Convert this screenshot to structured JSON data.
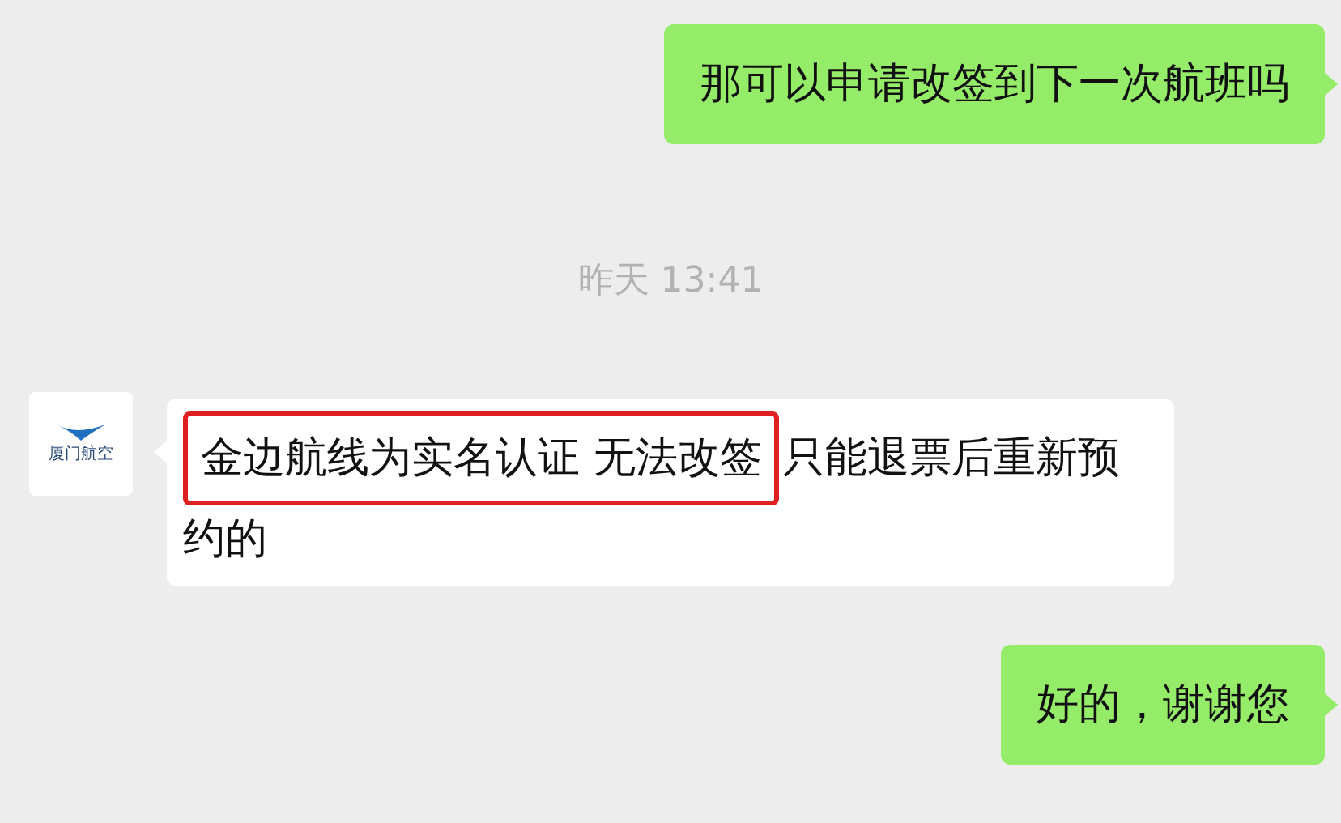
{
  "messages": [
    {
      "kind": "outgoing",
      "text": "那可以申请改签到下一次航班吗"
    },
    {
      "kind": "timestamp",
      "text": "昨天 13:41"
    },
    {
      "kind": "incoming",
      "avatar_label": "厦门航空",
      "highlighted": "金边航线为实名认证 无法改签",
      "text": "只能退票后重新预约的"
    },
    {
      "kind": "outgoing",
      "text": "好的，谢谢您"
    }
  ]
}
